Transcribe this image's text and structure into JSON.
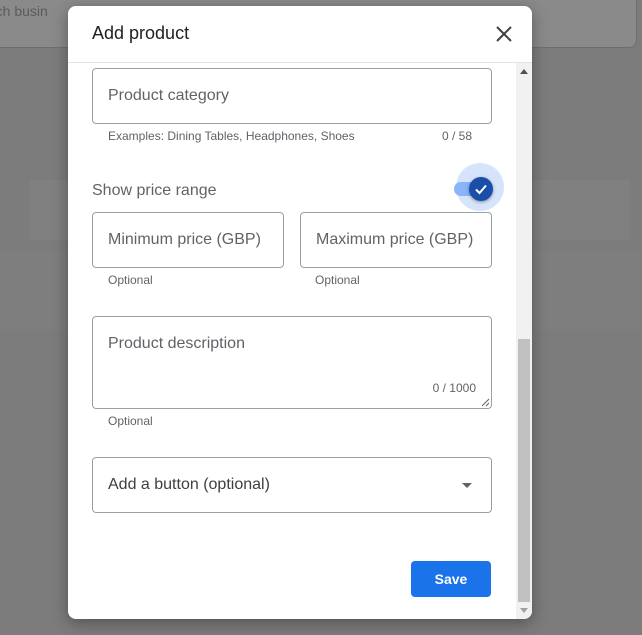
{
  "background": {
    "search_text": "rch busin"
  },
  "dialog": {
    "title": "Add product",
    "close_icon": "close-icon"
  },
  "form": {
    "category": {
      "placeholder": "Product category",
      "hint": "Examples: Dining Tables, Headphones, Shoes",
      "counter": "0 / 58"
    },
    "price_range": {
      "label": "Show price range",
      "enabled": true,
      "min_placeholder": "Minimum price (GBP)",
      "min_hint": "Optional",
      "max_placeholder": "Maximum price (GBP)",
      "max_hint": "Optional"
    },
    "description": {
      "placeholder": "Product description",
      "counter": "0 / 1000",
      "hint": "Optional"
    },
    "button_select": {
      "label": "Add a button (optional)"
    }
  },
  "actions": {
    "save_label": "Save"
  },
  "colors": {
    "primary": "#1a73e8",
    "toggle_knob": "#1a4ea8",
    "toggle_track": "#8ab4f8"
  }
}
